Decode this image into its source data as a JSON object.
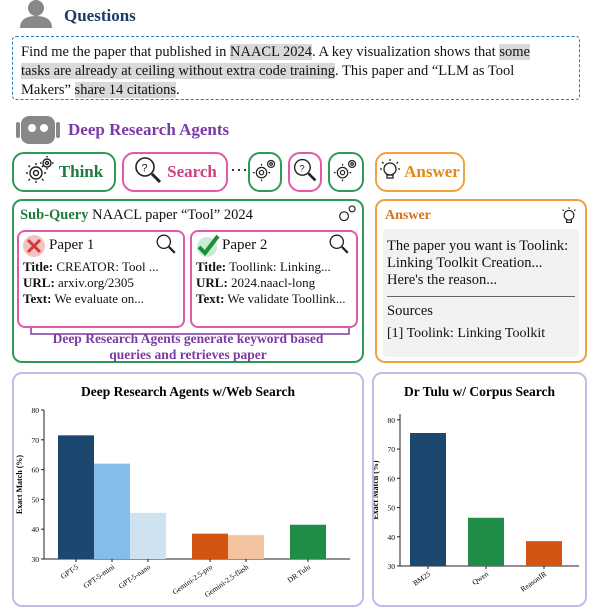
{
  "question": {
    "title": "Questions",
    "text_part1": "Find me the paper that published in ",
    "text_hl1": "NAACL 2024",
    "text_part2": ". A key visualization shows that ",
    "text_hl2a": "some",
    "text_hl2b": "tasks are already at ceiling without extra code training",
    "text_part3": ". This paper and “LLM as Tool",
    "text_part4": "Makers” ",
    "text_hl3": "share 14 citations",
    "text_part5": "."
  },
  "agents": {
    "title": "Deep Research Agents",
    "think_label": "Think",
    "search_label": "Search",
    "ellipsis": "···",
    "answer_label": "Answer",
    "subquery_prefix": "Sub-Query",
    "subquery_text": "NAACL paper  “Tool” 2024",
    "papers": [
      {
        "name": "Paper 1",
        "title_k": "Title:",
        "title_v": "CREATOR: Tool ...",
        "url_k": "URL:",
        "url_v": "arxiv.org/2305",
        "text_k": "Text:",
        "text_v": "We evaluate on..."
      },
      {
        "name": "Paper 2",
        "title_k": "Title:",
        "title_v": "Toollink: Linking...",
        "url_k": "URL:",
        "url_v": "2024.naacl-long",
        "text_k": "Text:",
        "text_v": "We validate Toollink..."
      }
    ],
    "caption_line1": "Deep Research Agents generate keyword based",
    "caption_line2": "queries and retrieves paper",
    "answer_title": "Answer",
    "answer_line1": "The paper you want is Toolink:",
    "answer_line2": "Linking Toolkit Creation...",
    "answer_line3": "Here's the reason...",
    "sources_label": "Sources",
    "source1": "[1] Toolink: Linking Toolkit"
  },
  "colors": {
    "green": "#2e9a55",
    "pink": "#e05aa6",
    "orange": "#f0a23c",
    "purple": "#7b3aa6",
    "blue_border": "#2a78c8"
  },
  "chart_data": [
    {
      "type": "bar",
      "title": "Deep Research Agents w/Web Search",
      "ylabel": "Exact Match (%)",
      "ylim": [
        30,
        80
      ],
      "yticks": [
        30,
        40,
        50,
        60,
        70,
        80
      ],
      "categories": [
        "GPT-5",
        "GPT-5-mini",
        "GPT-5-nano",
        "Gemini-2.5-pro",
        "Gemini-2.5-flash",
        "DR Tulu"
      ],
      "values": [
        71.5,
        62,
        45.5,
        38.5,
        38,
        41.5
      ],
      "colors": [
        "#1c4870",
        "#86bde8",
        "#cfe2f0",
        "#d2560f",
        "#f2c39e",
        "#1f8c48"
      ]
    },
    {
      "type": "bar",
      "title": "Dr Tulu w/ Corpus Search",
      "ylabel": "Exact Match (%)",
      "ylim": [
        30,
        82
      ],
      "yticks": [
        30,
        40,
        50,
        60,
        70,
        80
      ],
      "categories": [
        "BM25",
        "Qwen",
        "ReasonIR"
      ],
      "values": [
        75.5,
        46.5,
        38.5
      ],
      "colors": [
        "#1c4870",
        "#1f8c48",
        "#d2560f"
      ]
    }
  ]
}
